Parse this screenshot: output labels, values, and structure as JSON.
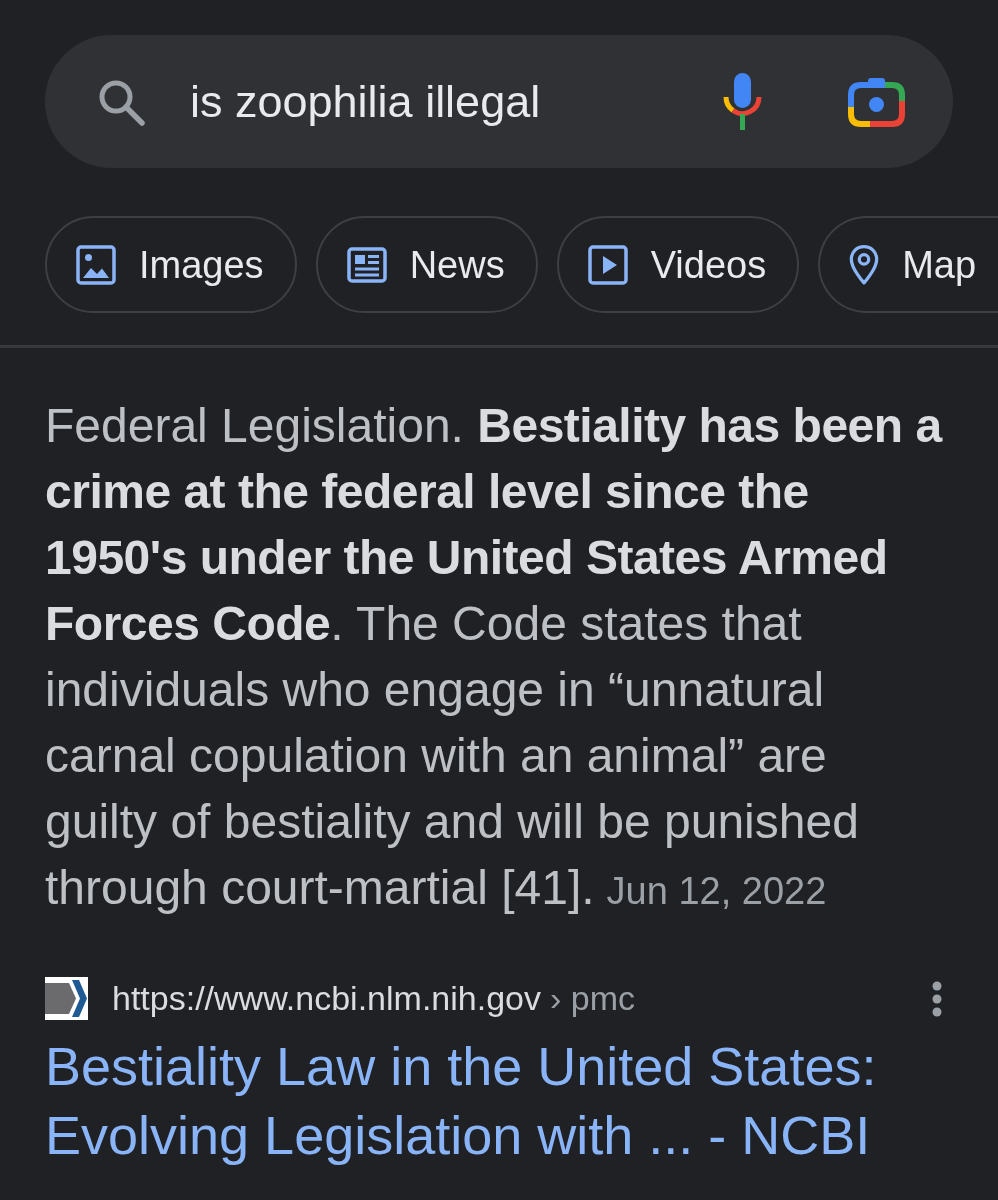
{
  "search": {
    "query": "is zoophilia illegal"
  },
  "chips": [
    {
      "label": "Images",
      "kind": "image"
    },
    {
      "label": "News",
      "kind": "news"
    },
    {
      "label": "Videos",
      "kind": "video"
    },
    {
      "label": "Map",
      "kind": "map"
    }
  ],
  "snippet": {
    "text": "Federal Legislation. **Bestiality has been a crime at the federal level since the 1950's under the United States Armed Forces Code**. The Code states that individuals who engage in “unnatural carnal copulation with an animal” are guilty of bestiality and will be punished through court-martial [41].",
    "date": "Jun 12, 2022"
  },
  "result": {
    "url": "https://www.ncbi.nlm.nih.gov",
    "breadcrumb": "› pmc",
    "title": "Bestiality Law in the United States: Evolving Legislation with ... - NCBI"
  }
}
